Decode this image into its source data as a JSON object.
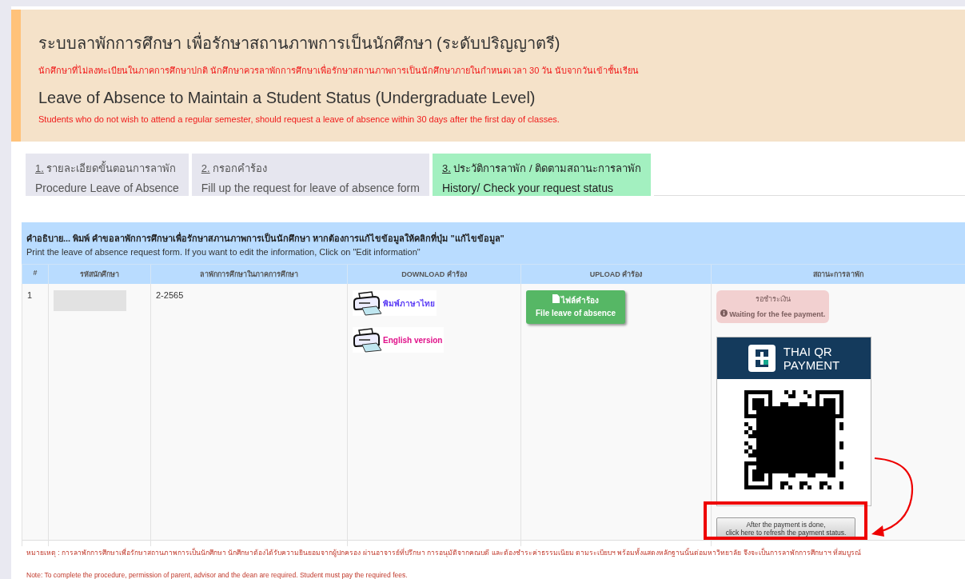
{
  "header": {
    "title_th": "ระบบลาพักการศึกษา เพื่อรักษาสถานภาพการเป็นนักศึกษา (ระดับปริญญาตรี)",
    "notice_th": "นักศึกษาที่ไม่ลงทะเบียนในภาคการศึกษาปกติ นักศึกษาควรลาพักการศึกษาเพื่อรักษาสถานภาพการเป็นนักศึกษาภายในกำหนดเวลา 30 วัน นับจากวันเข้าชั้นเรียน",
    "title_en": "Leave of Absence to Maintain a Student Status (Undergraduate Level)",
    "notice_en": "Students who do not wish to attend a regular semester, should request a leave of absence within 30 days after the first day of classes."
  },
  "tabs": [
    {
      "number": "1.",
      "label_th": "รายละเอียดขั้นตอนการลาพัก",
      "label_en": "Procedure Leave of Absence",
      "selected": false
    },
    {
      "number": "2.",
      "label_th": "กรอกคำร้อง",
      "label_en": "Fill up the request for leave of absence form",
      "selected": false
    },
    {
      "number": "3.",
      "label_th": "ประวัติการลาพัก / ติดตามสถานะการลาพัก",
      "label_en": "History/ Check your request status",
      "selected": true
    }
  ],
  "panel": {
    "description_th": "คำอธิบาย... พิมพ์ คำขอลาพักการศึกษาเพื่อรักษาสภานภาพการเป็นนักศึกษา หากต้องการแก้ไขข้อมูลให้คลิกที่ปุ่ม \"แก้ไขข้อมูล\"",
    "description_en": "Print the leave of absence request form. If you want to edit the information, Click on \"Edit information\""
  },
  "table": {
    "columns": [
      "#",
      "รหัสนักศึกษา",
      "ลาพักการศึกษาในภาคการศึกษา",
      "DOWNLOAD คำร้อง",
      "UPLOAD คำร้อง",
      "สถานะการลาพัก"
    ],
    "rows": [
      {
        "index": "1",
        "semester": "2-2565",
        "downloads": [
          {
            "label": "พิมพ์ภาษาไทย",
            "kind": "thai"
          },
          {
            "label": "English version",
            "kind": "english"
          }
        ],
        "upload": {
          "label_th": "ไฟล์คำร้อง",
          "label_en": "File leave of absence"
        },
        "status": {
          "label_th": "รอชำระเงิน",
          "label_en": "Waiting for the fee payment."
        },
        "qr": {
          "brand_line1": "THAI QR",
          "brand_line2": "PAYMENT"
        },
        "refresh_button": [
          "After the payment is done,",
          "click here to refresh the payment status."
        ]
      }
    ]
  },
  "notes": [
    "หมายเหตุ : การลาพักการศึกษาเพื่อรักษาสถานภาพการเป็นนักศึกษา นักศึกษาต้องได้รับความยินยอมจากผู้ปกครอง ผ่านอาจารย์ที่ปรึกษา การอนุมัติจากคณบดี และต้องชำระค่าธรรมเนียม ตามระเบียบฯ พร้อมทั้งแสดงหลักฐานนั้นต่อมหาวิทยาลัย จึงจะเป็นการลาพักการศึกษาฯ ที่สมบูรณ์",
    "Note: To complete the procedure, permission of parent, advisor and the dean are required. Student must pay the required fees."
  ]
}
